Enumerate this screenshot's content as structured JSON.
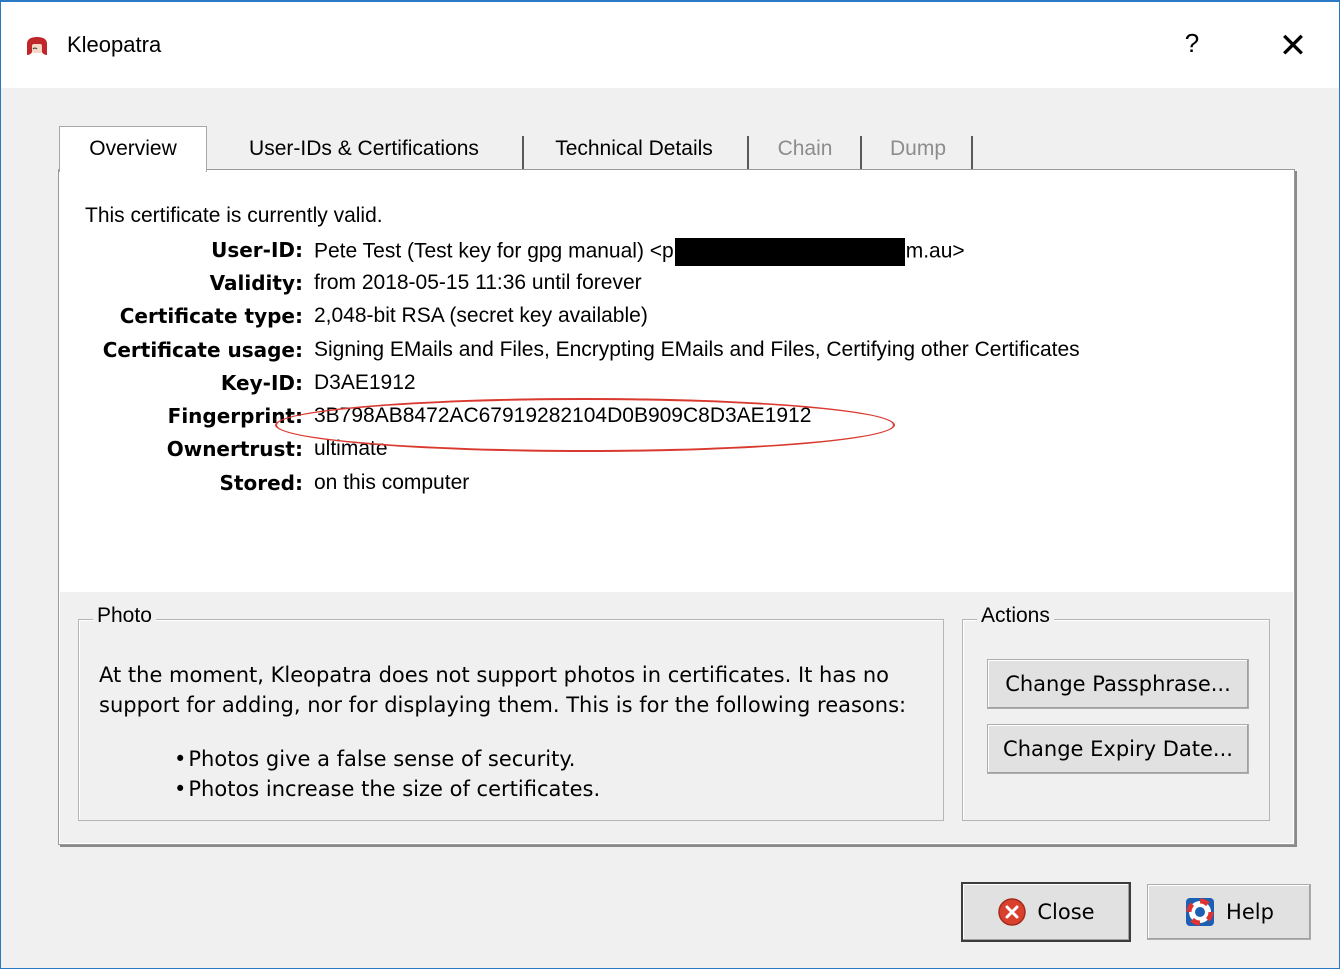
{
  "window": {
    "title": "Kleopatra",
    "help_glyph": "?",
    "close_glyph": "✕"
  },
  "tabs": [
    {
      "label": "Overview",
      "state": "active"
    },
    {
      "label": "User-IDs & Certifications",
      "state": "enabled"
    },
    {
      "label": "Technical Details",
      "state": "enabled"
    },
    {
      "label": "Chain",
      "state": "disabled"
    },
    {
      "label": "Dump",
      "state": "disabled"
    }
  ],
  "overview": {
    "status": "This certificate is currently valid.",
    "fields": [
      {
        "label": "User-ID:",
        "value_prefix": "Pete Test (Test key for gpg manual) <p",
        "value_suffix": "m.au>",
        "redacted": true
      },
      {
        "label": "Validity:",
        "value": "from 2018-05-15 11:36 until forever"
      },
      {
        "label": "Certificate type:",
        "value": "2,048-bit RSA (secret key available)"
      },
      {
        "label": "Certificate usage:",
        "value": "Signing EMails and Files, Encrypting EMails and Files, Certifying other Certificates"
      },
      {
        "label": "Key-ID:",
        "value": "D3AE1912"
      },
      {
        "label": "Fingerprint:",
        "value": "3B798AB8472AC67919282104D0B909C8D3AE1912"
      },
      {
        "label": "Ownertrust:",
        "value": "ultimate"
      },
      {
        "label": "Stored:",
        "value": "on this computer"
      }
    ],
    "highlight_color": "#d9392f"
  },
  "photo": {
    "title": "Photo",
    "text": "At the moment, Kleopatra does not support photos in certificates. It has no support for adding, nor for displaying them. This is for the following reasons:",
    "bullets": [
      "Photos give a false sense of security.",
      "Photos increase the size of certificates."
    ]
  },
  "actions": {
    "title": "Actions",
    "change_passphrase": "Change Passphrase...",
    "change_expiry": "Change Expiry Date..."
  },
  "footer": {
    "close_label": "Close",
    "help_label": "Help",
    "close_icon": "close-circle-icon",
    "help_icon": "help-lifebuoy-icon"
  }
}
